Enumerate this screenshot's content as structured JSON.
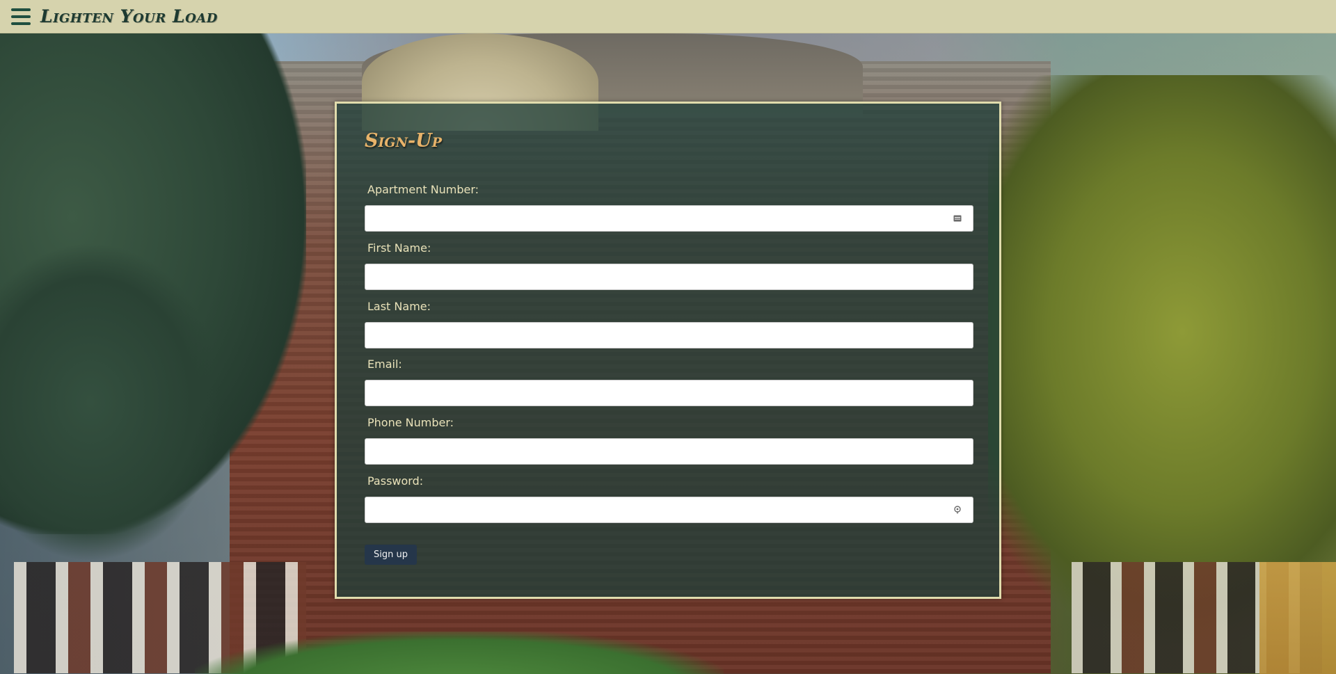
{
  "header": {
    "brand": "Lighten Your Load"
  },
  "form": {
    "title": "Sign-Up",
    "fields": [
      {
        "label": "Apartment Number:",
        "value": "",
        "icon": "autofill-card-icon"
      },
      {
        "label": "First Name:",
        "value": ""
      },
      {
        "label": "Last Name:",
        "value": ""
      },
      {
        "label": "Email:",
        "value": ""
      },
      {
        "label": "Phone Number:",
        "value": ""
      },
      {
        "label": "Password:",
        "value": "",
        "icon": "password-key-icon"
      }
    ],
    "submit_label": "Sign up"
  },
  "colors": {
    "header_bg": "#d6d3ad",
    "brand_text": "#1d3a31",
    "panel_bg": "#1f3f3a",
    "panel_border": "#e1dcad",
    "title_text": "#e8b36a",
    "label_text": "#e9e2b9",
    "button_bg": "#25364a"
  }
}
